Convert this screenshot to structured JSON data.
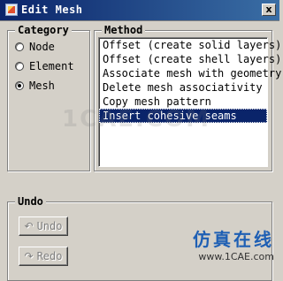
{
  "window": {
    "title": "Edit Mesh",
    "close_glyph": "x"
  },
  "category": {
    "label": "Category",
    "options": [
      {
        "label": "Node",
        "selected": false
      },
      {
        "label": "Element",
        "selected": false
      },
      {
        "label": "Mesh",
        "selected": true
      }
    ]
  },
  "method": {
    "label": "Method",
    "items": [
      "Offset (create solid layers)",
      "Offset (create shell layers)",
      "Associate mesh with geometry",
      "Delete mesh associativity",
      "Copy mesh pattern",
      "Insert cohesive seams"
    ],
    "selected_index": 5
  },
  "undo": {
    "label": "Undo",
    "undo_button": "Undo",
    "redo_button": "Redo",
    "undo_icon": "undo-arrow-icon",
    "redo_icon": "redo-arrow-icon"
  },
  "watermark": {
    "center": "1CAE.COM",
    "brand": "仿真在线",
    "url": "www.1CAE.com"
  }
}
